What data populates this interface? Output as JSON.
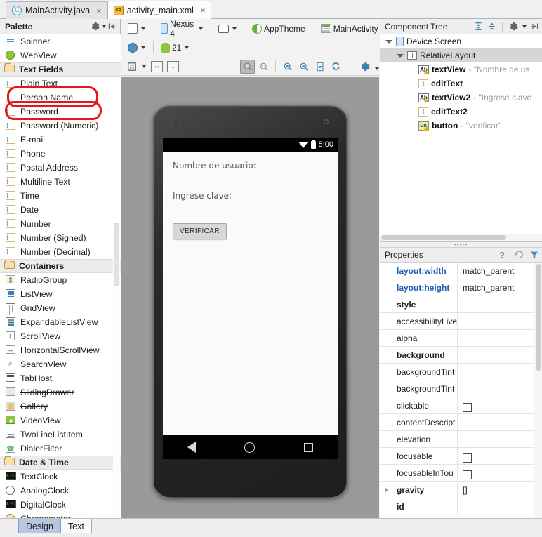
{
  "editor_tabs": [
    {
      "label": "MainActivity.java",
      "icon": "java-class-icon",
      "active": false,
      "close": "×"
    },
    {
      "label": "activity_main.xml",
      "icon": "xml-layout-icon",
      "active": true,
      "close": "×"
    }
  ],
  "palette": {
    "title": "Palette",
    "gear_icon": "gear-icon",
    "collapse_icon": "collapse-panel-icon",
    "items": [
      {
        "label": "Spinner",
        "icon": "spinner-icon",
        "type": "item",
        "deprecated": false
      },
      {
        "label": "WebView",
        "icon": "webview-icon",
        "type": "item",
        "deprecated": false
      },
      {
        "label": "Text Fields",
        "icon": "folder-icon",
        "type": "group",
        "deprecated": false
      },
      {
        "label": "Plain Text",
        "icon": "edittext-icon",
        "type": "item",
        "deprecated": false
      },
      {
        "label": "Person Name",
        "icon": "edittext-icon",
        "type": "item",
        "deprecated": false
      },
      {
        "label": "Password",
        "icon": "edittext-icon",
        "type": "item",
        "deprecated": false
      },
      {
        "label": "Password (Numeric)",
        "icon": "edittext-icon",
        "type": "item",
        "deprecated": false
      },
      {
        "label": "E-mail",
        "icon": "edittext-icon",
        "type": "item",
        "deprecated": false
      },
      {
        "label": "Phone",
        "icon": "edittext-icon",
        "type": "item",
        "deprecated": false
      },
      {
        "label": "Postal Address",
        "icon": "edittext-icon",
        "type": "item",
        "deprecated": false
      },
      {
        "label": "Multiline Text",
        "icon": "edittext-icon",
        "type": "item",
        "deprecated": false
      },
      {
        "label": "Time",
        "icon": "edittext-icon",
        "type": "item",
        "deprecated": false
      },
      {
        "label": "Date",
        "icon": "edittext-icon",
        "type": "item",
        "deprecated": false
      },
      {
        "label": "Number",
        "icon": "edittext-icon",
        "type": "item",
        "deprecated": false
      },
      {
        "label": "Number (Signed)",
        "icon": "edittext-icon",
        "type": "item",
        "deprecated": false
      },
      {
        "label": "Number (Decimal)",
        "icon": "edittext-icon",
        "type": "item",
        "deprecated": false
      },
      {
        "label": "Containers",
        "icon": "folder-icon",
        "type": "group",
        "deprecated": false
      },
      {
        "label": "RadioGroup",
        "icon": "radiogroup-icon",
        "type": "item",
        "deprecated": false
      },
      {
        "label": "ListView",
        "icon": "listview-icon",
        "type": "item",
        "deprecated": false
      },
      {
        "label": "GridView",
        "icon": "gridview-icon",
        "type": "item",
        "deprecated": false
      },
      {
        "label": "ExpandableListView",
        "icon": "expandablelistview-icon",
        "type": "item",
        "deprecated": false
      },
      {
        "label": "ScrollView",
        "icon": "scrollview-icon",
        "type": "item",
        "deprecated": false
      },
      {
        "label": "HorizontalScrollView",
        "icon": "horizontalscrollview-icon",
        "type": "item",
        "deprecated": false
      },
      {
        "label": "SearchView",
        "icon": "search-icon",
        "type": "item",
        "deprecated": false
      },
      {
        "label": "TabHost",
        "icon": "tabhost-icon",
        "type": "item",
        "deprecated": false
      },
      {
        "label": "SlidingDrawer",
        "icon": "slidingdrawer-icon",
        "type": "item",
        "deprecated": true
      },
      {
        "label": "Gallery",
        "icon": "gallery-icon",
        "type": "item",
        "deprecated": true
      },
      {
        "label": "VideoView",
        "icon": "videoview-icon",
        "type": "item",
        "deprecated": false
      },
      {
        "label": "TwoLineListItem",
        "icon": "twolinelistitem-icon",
        "type": "item",
        "deprecated": true
      },
      {
        "label": "DialerFilter",
        "icon": "dialerfilter-icon",
        "type": "item",
        "deprecated": false
      },
      {
        "label": "Date & Time",
        "icon": "folder-icon",
        "type": "group",
        "deprecated": false
      },
      {
        "label": "TextClock",
        "icon": "textclock-icon",
        "type": "item",
        "deprecated": false
      },
      {
        "label": "AnalogClock",
        "icon": "analogclock-icon",
        "type": "item",
        "deprecated": false
      },
      {
        "label": "DigitalClock",
        "icon": "digitalclock-icon",
        "type": "item",
        "deprecated": true
      },
      {
        "label": "Chronometer",
        "icon": "chronometer-icon",
        "type": "item",
        "deprecated": false
      }
    ]
  },
  "annotations": {
    "color": "#e8161a",
    "marks": [
      {
        "target": "Person Name",
        "shape": "ellipse"
      },
      {
        "target": "Password",
        "shape": "ellipse"
      }
    ]
  },
  "design_toolbar": {
    "row1": [
      {
        "label": "",
        "icon": "device-config-icon",
        "dropdown": true
      },
      {
        "label": "Nexus 4",
        "icon": "device-icon",
        "dropdown": true
      },
      {
        "label": "",
        "icon": "orientation-icon",
        "dropdown": true
      },
      {
        "label": "AppTheme",
        "icon": "theme-icon",
        "dropdown": false
      },
      {
        "label": "MainActivity",
        "icon": "activity-icon",
        "dropdown": true
      }
    ],
    "row2": [
      {
        "label": "",
        "icon": "locale-icon",
        "dropdown": true
      },
      {
        "label": "21",
        "icon": "api-level-icon",
        "dropdown": true
      }
    ],
    "row3_left": [
      {
        "icon": "zoom-to-fit-icon",
        "dropdown": true
      },
      {
        "icon": "fit-width-icon",
        "dropdown": false
      },
      {
        "icon": "fit-height-icon",
        "dropdown": false
      }
    ],
    "row3_right": [
      {
        "icon": "zoom-fit-selection-icon",
        "pressed": true
      },
      {
        "icon": "zoom-actual-size-icon",
        "pressed": false
      },
      {
        "icon": "zoom-in-icon",
        "pressed": false
      },
      {
        "icon": "zoom-out-icon",
        "pressed": false
      },
      {
        "icon": "render-log-icon",
        "pressed": false
      },
      {
        "icon": "refresh-icon",
        "pressed": false
      },
      {
        "icon": "settings-gear-icon",
        "pressed": false
      }
    ]
  },
  "preview": {
    "device": "Nexus 4",
    "status_bar": {
      "clock": "5:00",
      "wifi_icon": "wifi-icon",
      "battery_icon": "battery-icon"
    },
    "widgets": [
      {
        "kind": "label",
        "text": "Nombre de usuario:"
      },
      {
        "kind": "edittext",
        "text": ""
      },
      {
        "kind": "label",
        "text": "Ingrese clave:"
      },
      {
        "kind": "edittext",
        "text": ""
      },
      {
        "kind": "button",
        "text": "VERIFICAR"
      }
    ],
    "nav_bar": [
      {
        "icon": "nav-back-icon"
      },
      {
        "icon": "nav-home-icon"
      },
      {
        "icon": "nav-recents-icon"
      }
    ]
  },
  "component_tree": {
    "title": "Component Tree",
    "toolbar": [
      {
        "icon": "expand-all-icon"
      },
      {
        "icon": "collapse-all-icon"
      },
      {
        "icon": "gear-icon"
      },
      {
        "icon": "hide-panel-icon"
      }
    ],
    "nodes": [
      {
        "depth": 0,
        "name": "Device Screen",
        "value": "",
        "icon": "device-screen-icon",
        "expanded": true,
        "selected": false,
        "warning": false,
        "bold": false
      },
      {
        "depth": 1,
        "name": "RelativeLayout",
        "value": "",
        "icon": "relativelayout-icon",
        "expanded": true,
        "selected": true,
        "warning": false,
        "bold": false
      },
      {
        "depth": 2,
        "name": "textView",
        "value": "- \"Nombre de us",
        "icon": "textview-icon",
        "expanded": false,
        "selected": false,
        "warning": true,
        "bold": true
      },
      {
        "depth": 2,
        "name": "editText",
        "value": "",
        "icon": "edittext-icon",
        "expanded": false,
        "selected": false,
        "warning": false,
        "bold": true
      },
      {
        "depth": 2,
        "name": "textView2",
        "value": "- \"Ingrese clave",
        "icon": "textview-icon",
        "expanded": false,
        "selected": false,
        "warning": true,
        "bold": true
      },
      {
        "depth": 2,
        "name": "editText2",
        "value": "",
        "icon": "edittext-icon",
        "expanded": false,
        "selected": false,
        "warning": false,
        "bold": true
      },
      {
        "depth": 2,
        "name": "button",
        "value": "- \"verificar\"",
        "icon": "button-icon",
        "expanded": false,
        "selected": false,
        "warning": true,
        "bold": true
      }
    ]
  },
  "properties": {
    "title": "Properties",
    "toolbar": [
      {
        "icon": "help-icon"
      },
      {
        "icon": "reset-icon"
      },
      {
        "icon": "filter-icon"
      }
    ],
    "rows": [
      {
        "name": "layout:width",
        "value": "match_parent",
        "style": "layout",
        "control": "text",
        "expander": false
      },
      {
        "name": "layout:height",
        "value": "match_parent",
        "style": "layout",
        "control": "text",
        "expander": false
      },
      {
        "name": "style",
        "value": "",
        "style": "bold",
        "control": "text",
        "expander": false
      },
      {
        "name": "accessibilityLive",
        "value": "",
        "style": "normal",
        "control": "text",
        "expander": false
      },
      {
        "name": "alpha",
        "value": "",
        "style": "normal",
        "control": "text",
        "expander": false
      },
      {
        "name": "background",
        "value": "",
        "style": "bold",
        "control": "text",
        "expander": false
      },
      {
        "name": "backgroundTint",
        "value": "",
        "style": "normal",
        "control": "text",
        "expander": false
      },
      {
        "name": "backgroundTint",
        "value": "",
        "style": "normal",
        "control": "text",
        "expander": false
      },
      {
        "name": "clickable",
        "value": "",
        "style": "normal",
        "control": "checkbox",
        "expander": false
      },
      {
        "name": "contentDescript",
        "value": "",
        "style": "normal",
        "control": "text",
        "expander": false
      },
      {
        "name": "elevation",
        "value": "",
        "style": "normal",
        "control": "text",
        "expander": false
      },
      {
        "name": "focusable",
        "value": "",
        "style": "normal",
        "control": "checkbox",
        "expander": false
      },
      {
        "name": "focusableInTou",
        "value": "",
        "style": "normal",
        "control": "checkbox",
        "expander": false
      },
      {
        "name": "gravity",
        "value": "[]",
        "style": "bold",
        "control": "text",
        "expander": true
      },
      {
        "name": "id",
        "value": "",
        "style": "bold",
        "control": "text",
        "expander": false
      }
    ]
  },
  "bottom_tabs": [
    {
      "label": "Design",
      "active": true
    },
    {
      "label": "Text",
      "active": false
    }
  ]
}
